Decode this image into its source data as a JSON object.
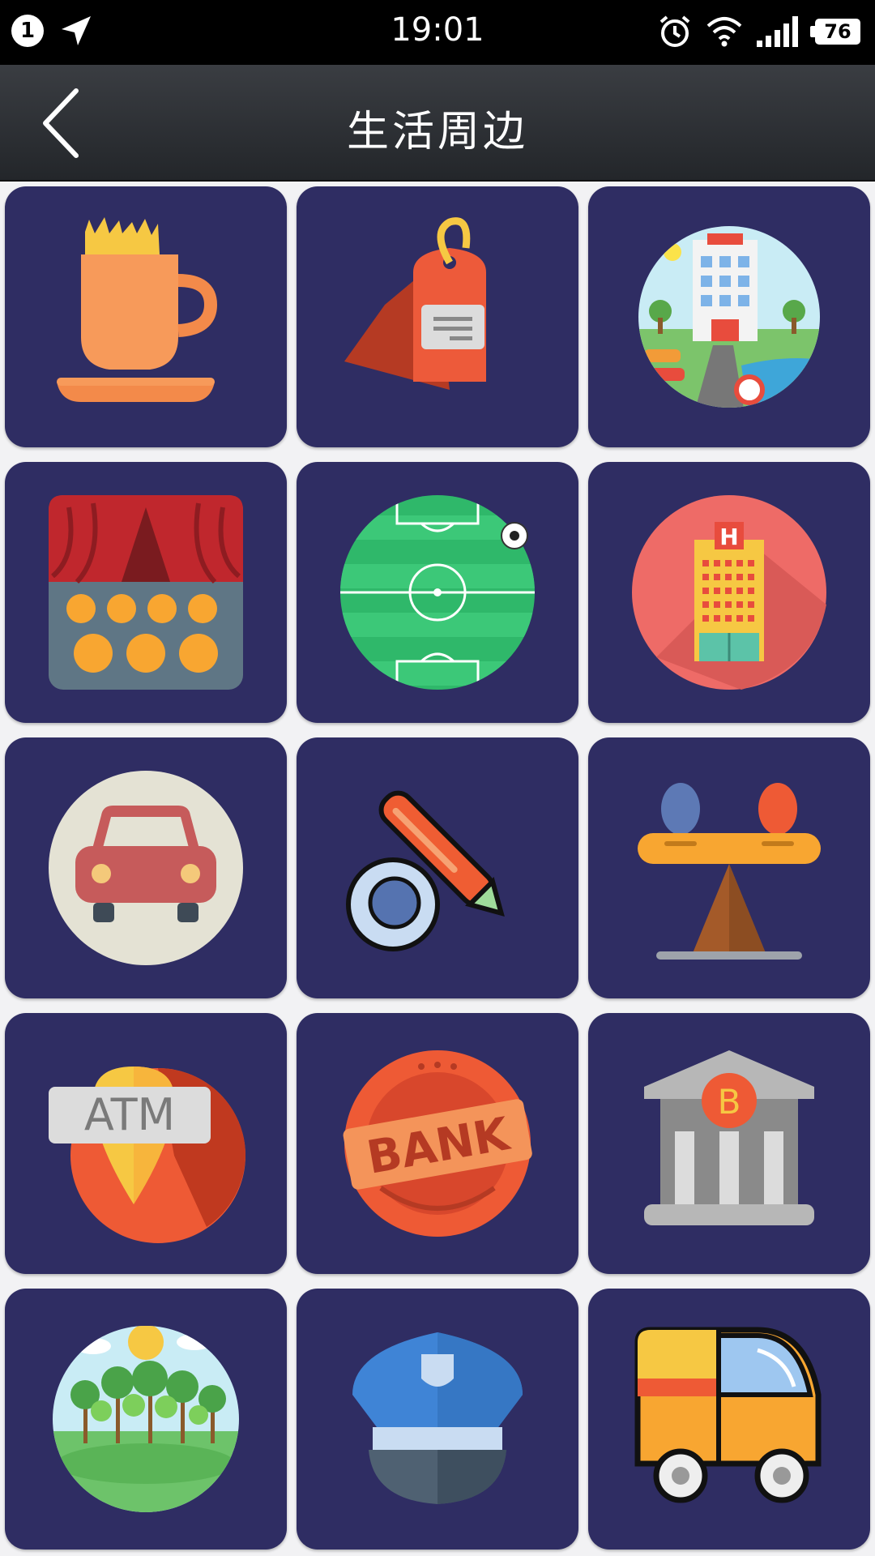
{
  "status_bar": {
    "notification_count": "1",
    "time": "19:01",
    "battery": "76"
  },
  "app_bar": {
    "title": "生活周边"
  },
  "grid": {
    "tiles": [
      {
        "icon": "coffee-icon"
      },
      {
        "icon": "shopping-tag-icon"
      },
      {
        "icon": "hotel-icon"
      },
      {
        "icon": "theater-icon"
      },
      {
        "icon": "football-field-icon"
      },
      {
        "icon": "hospital-icon"
      },
      {
        "icon": "car-icon"
      },
      {
        "icon": "fountain-pen-icon"
      },
      {
        "icon": "seesaw-icon"
      },
      {
        "icon": "atm-icon",
        "label": "ATM"
      },
      {
        "icon": "bank-stamp-icon",
        "label": "BANK"
      },
      {
        "icon": "bank-building-icon",
        "label": "B"
      },
      {
        "icon": "park-icon"
      },
      {
        "icon": "police-hat-icon"
      },
      {
        "icon": "delivery-van-icon"
      }
    ]
  },
  "colors": {
    "tile_background": "#2f2d63",
    "app_bar": "#2b2e33",
    "status_bar": "#000000"
  }
}
